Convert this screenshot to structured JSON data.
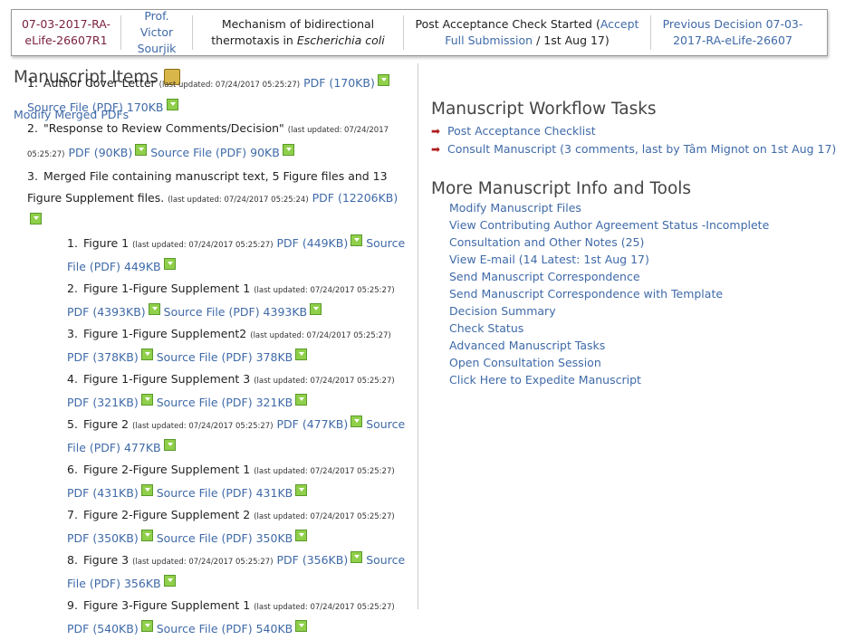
{
  "header": {
    "msid": "07-03-2017-RA-eLife-26607R1",
    "author": "Prof. Victor Sourjik",
    "title_main": "Mechanism of bidirectional thermotaxis in ",
    "title_italic": "Escherichia coli",
    "status_text": "Post Acceptance Check Started (",
    "status_link": "Accept Full Submission",
    "status_tail": " / 1st Aug 17)",
    "previous": "Previous Decision 07-03-2017-RA-eLife-26607"
  },
  "left": {
    "heading": "Manuscript Items",
    "modify": "Modify Merged PDFs",
    "items": [
      {
        "n": "1.",
        "label": "Author Cover Letter",
        "updated": "(last updated: 07/24/2017 05:25:27)",
        "pdf": "PDF (170KB)",
        "src": "Source File (PDF) 170KB"
      },
      {
        "n": "2.",
        "label": "\"Response to Review Comments/Decision\"",
        "updated": "(last updated: 07/24/2017 05:25:27)",
        "pdf": "PDF (90KB)",
        "src": "Source File (PDF) 90KB"
      },
      {
        "n": "3.",
        "label": "Merged File containing manuscript text, 5 Figure files and 13 Figure Supplement files.",
        "updated": "(last updated: 07/24/2017 05:25:24)",
        "pdf": "PDF (12206KB)",
        "src": ""
      }
    ],
    "subitems": [
      {
        "n": "1.",
        "label": "Figure 1",
        "updated": "(last updated: 07/24/2017 05:25:27)",
        "pdf": "PDF (449KB)",
        "src": "Source File (PDF) 449KB"
      },
      {
        "n": "2.",
        "label": "Figure 1-Figure Supplement 1",
        "updated": "(last updated: 07/24/2017 05:25:27)",
        "pdf": "PDF (4393KB)",
        "src": "Source File (PDF) 4393KB"
      },
      {
        "n": "3.",
        "label": "Figure 1-Figure Supplement2",
        "updated": "(last updated: 07/24/2017 05:25:27)",
        "pdf": "PDF (378KB)",
        "src": "Source File (PDF) 378KB"
      },
      {
        "n": "4.",
        "label": "Figure 1-Figure Supplement 3",
        "updated": "(last updated: 07/24/2017 05:25:27)",
        "pdf": "PDF (321KB)",
        "src": "Source File (PDF) 321KB"
      },
      {
        "n": "5.",
        "label": "Figure 2",
        "updated": "(last updated: 07/24/2017 05:25:27)",
        "pdf": "PDF (477KB)",
        "src": "Source File (PDF) 477KB"
      },
      {
        "n": "6.",
        "label": "Figure 2-Figure Supplement 1",
        "updated": "(last updated: 07/24/2017 05:25:27)",
        "pdf": "PDF (431KB)",
        "src": "Source File (PDF) 431KB"
      },
      {
        "n": "7.",
        "label": "Figure 2-Figure Supplement 2",
        "updated": "(last updated: 07/24/2017 05:25:27)",
        "pdf": "PDF (350KB)",
        "src": "Source File (PDF) 350KB"
      },
      {
        "n": "8.",
        "label": "Figure 3",
        "updated": "(last updated: 07/24/2017 05:25:27)",
        "pdf": "PDF (356KB)",
        "src": "Source File (PDF) 356KB"
      },
      {
        "n": "9.",
        "label": "Figure 3-Figure Supplement 1",
        "updated": "(last updated: 07/24/2017 05:25:27)",
        "pdf": "PDF (540KB)",
        "src": "Source File (PDF) 540KB"
      }
    ]
  },
  "right": {
    "tasks_heading": "Manuscript Workflow Tasks",
    "tasks": [
      "Post Acceptance Checklist",
      "Consult Manuscript (3 comments, last by Tâm Mignot on 1st Aug 17)"
    ],
    "tools_heading": "More Manuscript Info and Tools",
    "tools": [
      "Modify Manuscript Files",
      "View Contributing Author Agreement Status -Incomplete",
      "Consultation and Other Notes (25)",
      "View E-mail (14 Latest: 1st Aug 17)",
      "Send Manuscript Correspondence",
      "Send Manuscript Correspondence with Template",
      "Decision Summary",
      "Check Status",
      "Advanced Manuscript Tasks",
      "Open Consultation Session",
      "Click Here to Expedite Manuscript"
    ]
  },
  "colors": {
    "link": "#3f6aa8",
    "msid": "#7a1f3d",
    "arrow": "#b01c1c"
  },
  "icons": {
    "download": "green-download-icon",
    "task": "red-arrow-icon",
    "files": "file-stack-icon"
  }
}
